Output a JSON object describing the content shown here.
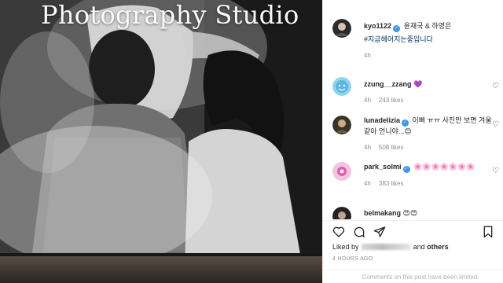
{
  "photo": {
    "overlay_text": "Photography Studio"
  },
  "post": {
    "author": "kyo1122",
    "tagged": "윤재국 & 하영은",
    "hashtag": "#지금헤어지는중입니다",
    "age": "4h"
  },
  "comments": [
    {
      "user": "zzung__zzang",
      "verified": false,
      "text": "💜",
      "age": "4h",
      "likes": "243 likes"
    },
    {
      "user": "lunadelizia",
      "verified": true,
      "text": "이뻐 ㅠㅠ 사진만 보면 겨울같아 언니야...😊",
      "age": "4h",
      "likes": "508 likes"
    },
    {
      "user": "park_solmi",
      "verified": true,
      "text": "🌸🌸🌸🌸🌸🌸🌸",
      "age": "4h",
      "likes": "383 likes"
    },
    {
      "user": "belmakang",
      "verified": false,
      "text": "😍😍",
      "age": "",
      "likes": ""
    }
  ],
  "actions": {
    "liked_by_prefix": "Liked by",
    "liked_by_suffix_and": "and",
    "liked_by_suffix_others": "others",
    "timestamp": "4 HOURS AGO",
    "comments_limited": "Comments on this post have been limited."
  },
  "icons": {
    "like": "heart-outline-icon",
    "comment": "comment-bubble-icon",
    "share": "paper-plane-icon",
    "save": "bookmark-icon",
    "comment_like": "small-heart-icon",
    "verified": "verified-badge-icon"
  },
  "colors": {
    "link": "#003569",
    "verified": "#3897f0",
    "muted": "#8e8e8e"
  }
}
